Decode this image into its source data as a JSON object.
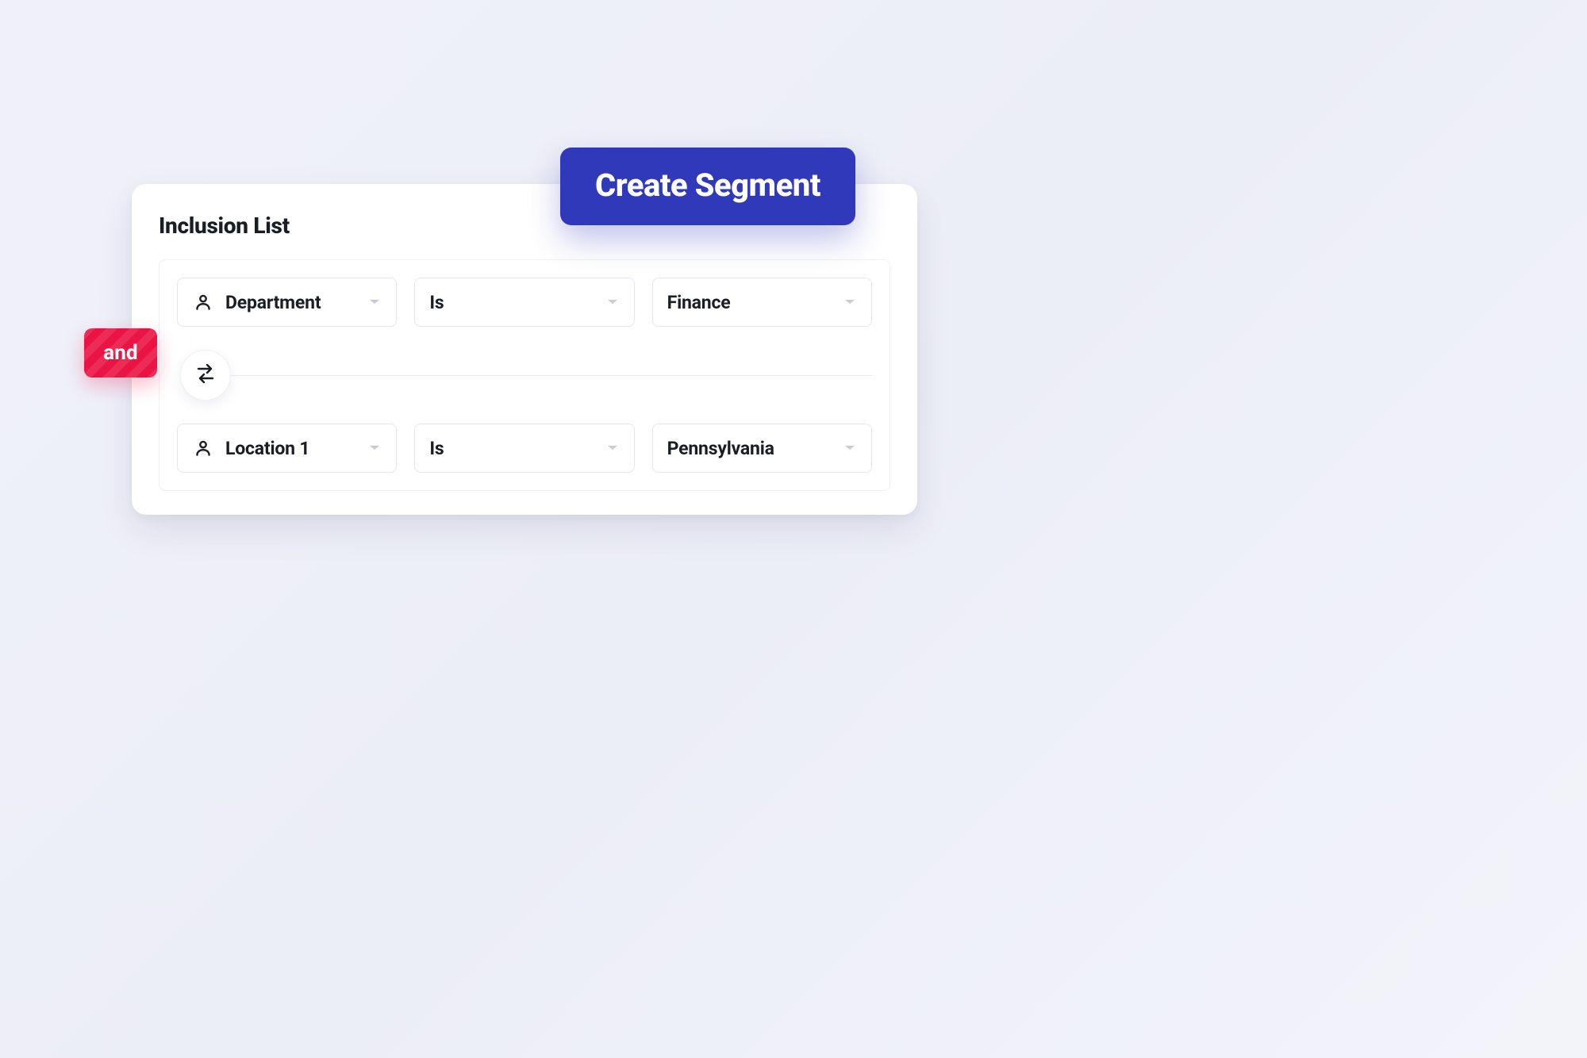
{
  "panel": {
    "title": "Inclusion List",
    "operator_label": "and"
  },
  "rules": [
    {
      "attribute": "Department",
      "condition": "Is",
      "value": "Finance"
    },
    {
      "attribute": "Location 1",
      "condition": "Is",
      "value": "Pennsylvania"
    }
  ],
  "actions": {
    "create_segment_label": "Create Segment"
  },
  "icons": {
    "attribute": "person-icon",
    "swap": "swap-horizontal-icon",
    "dropdown": "chevron-down-icon"
  }
}
